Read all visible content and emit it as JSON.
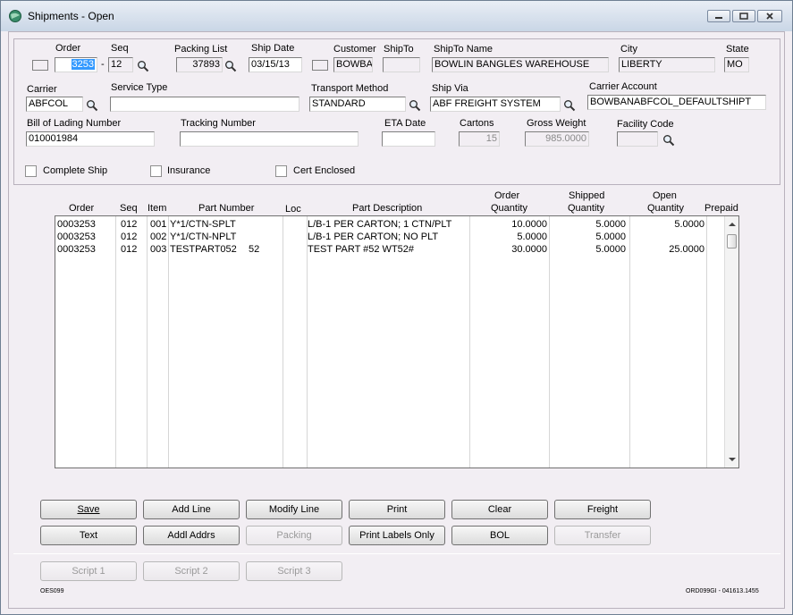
{
  "window": {
    "title": "Shipments - Open"
  },
  "header": {
    "order_label": "Order",
    "order_value": "3253",
    "order_sep": "-",
    "seq_label": "Seq",
    "seq_value": "12",
    "packing_list_label": "Packing List",
    "packing_list_value": "37893",
    "ship_date_label": "Ship Date",
    "ship_date_value": "03/15/13",
    "customer_label": "Customer",
    "customer_value": "BOWBAI",
    "shipto_label": "ShipTo",
    "shipto_value": "",
    "shipto_name_label": "ShipTo Name",
    "shipto_name_value": "BOWLIN BANGLES WAREHOUSE",
    "city_label": "City",
    "city_value": "LIBERTY",
    "state_label": "State",
    "state_value": "MO",
    "carrier_label": "Carrier",
    "carrier_value": "ABFCOL",
    "service_type_label": "Service Type",
    "service_type_value": "",
    "transport_method_label": "Transport Method",
    "transport_method_value": "STANDARD",
    "ship_via_label": "Ship Via",
    "ship_via_value": "ABF FREIGHT SYSTEM",
    "carrier_account_label": "Carrier Account",
    "carrier_account_value": "BOWBANABFCOL_DEFAULTSHIPT",
    "bol_label": "Bill of Lading Number",
    "bol_value": "010001984",
    "tracking_label": "Tracking Number",
    "tracking_value": "",
    "eta_label": "ETA Date",
    "eta_value": "",
    "cartons_label": "Cartons",
    "cartons_value": "15",
    "gross_weight_label": "Gross Weight",
    "gross_weight_value": "985.0000",
    "facility_label": "Facility Code",
    "facility_value": "",
    "complete_ship_label": "Complete Ship",
    "insurance_label": "Insurance",
    "cert_enclosed_label": "Cert Enclosed"
  },
  "grid": {
    "headers": {
      "order": "Order",
      "seq": "Seq",
      "item": "Item",
      "part_number": "Part Number",
      "loc": "Loc",
      "part_description": "Part Description",
      "order_qty_1": "Order",
      "order_qty_2": "Quantity",
      "shipped_qty_1": "Shipped",
      "shipped_qty_2": "Quantity",
      "open_qty_1": "Open",
      "open_qty_2": "Quantity",
      "prepaid": "Prepaid"
    },
    "rows": [
      {
        "order": "0003253",
        "seq": "012",
        "item": "001",
        "part": "Y*1/CTN-SPLT",
        "loc": "",
        "desc": "L/B-1 PER CARTON; 1 CTN/PLT",
        "order_qty": "10.0000",
        "shipped_qty": "5.0000",
        "open_qty": "5.0000",
        "prepaid": ""
      },
      {
        "order": "0003253",
        "seq": "012",
        "item": "002",
        "part": "Y*1/CTN-NPLT",
        "loc": "",
        "desc": "L/B-1 PER CARTON; NO PLT",
        "order_qty": "5.0000",
        "shipped_qty": "5.0000",
        "open_qty": "",
        "prepaid": ""
      },
      {
        "order": "0003253",
        "seq": "012",
        "item": "003",
        "part": "TESTPART052",
        "loc": "52",
        "desc": "TEST PART #52 WT52#",
        "order_qty": "30.0000",
        "shipped_qty": "5.0000",
        "open_qty": "25.0000",
        "prepaid": ""
      }
    ]
  },
  "buttons": {
    "save": "Save",
    "add_line": "Add Line",
    "modify_line": "Modify Line",
    "print": "Print",
    "clear": "Clear",
    "freight": "Freight",
    "text": "Text",
    "addl_addrs": "Addl Addrs",
    "packing": "Packing",
    "print_labels_only": "Print Labels Only",
    "bol": "BOL",
    "transfer": "Transfer",
    "script1": "Script 1",
    "script2": "Script 2",
    "script3": "Script 3"
  },
  "footer": {
    "left": "OES099",
    "right": "ORD099GI - 041613.1455"
  },
  "icons": {
    "app": "app-globe-icon",
    "lookup": "magnifier-icon",
    "minimize": "minimize-icon",
    "maximize": "maximize-icon",
    "close": "close-icon"
  },
  "colors": {
    "selection": "#3399ff",
    "window_bg": "#f2eef3"
  }
}
